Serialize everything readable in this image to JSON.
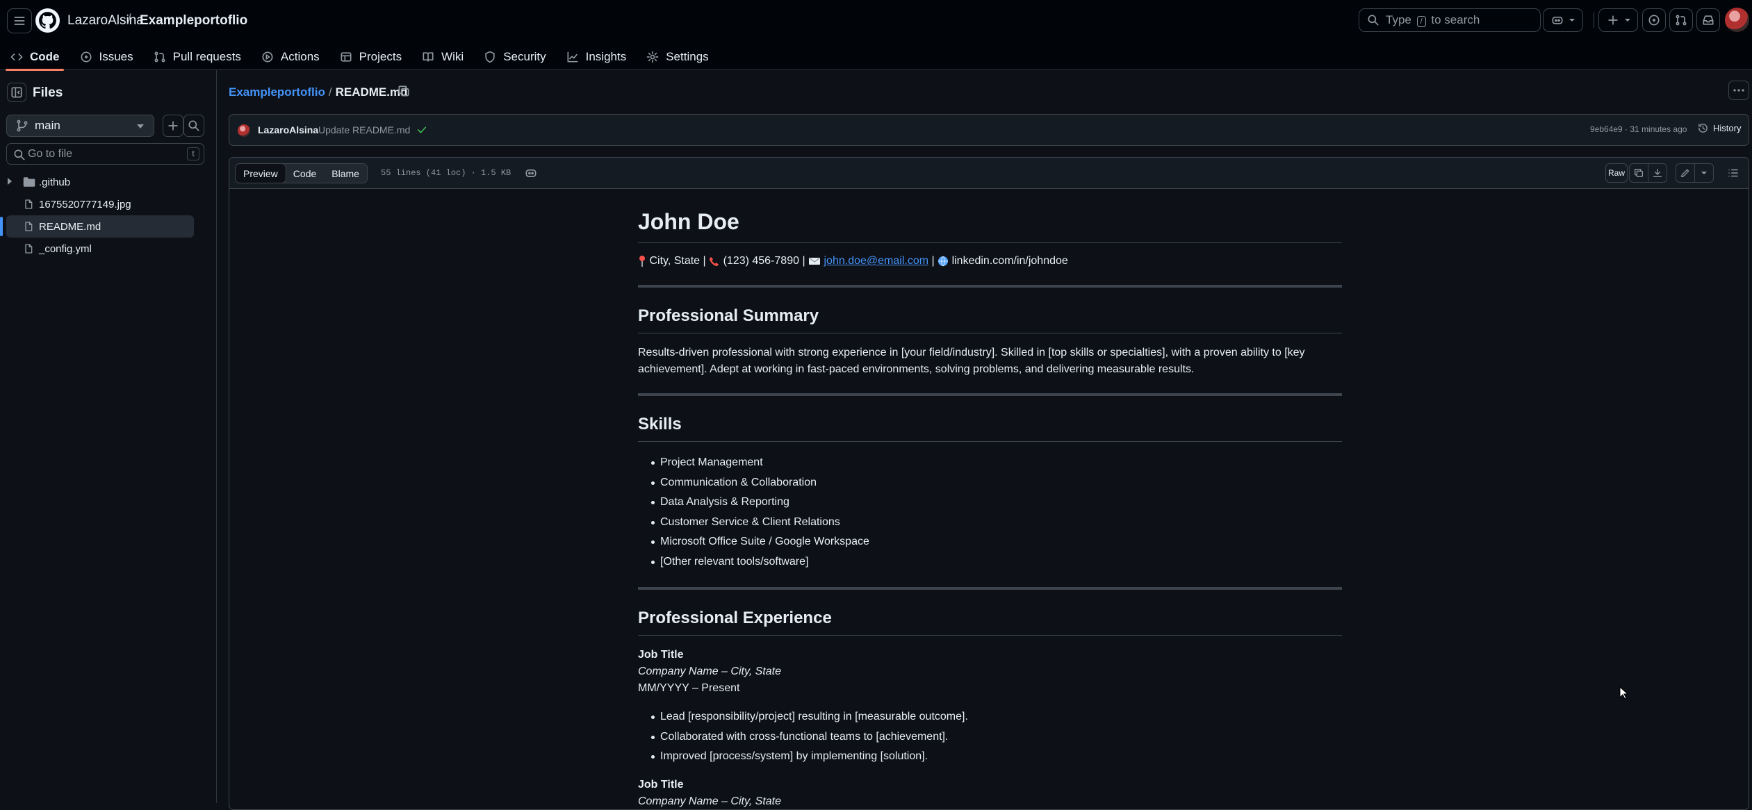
{
  "header": {
    "owner": "LazaroAlsina",
    "separator": "/",
    "repo": "Exampleportoflio",
    "search_prefix": "Type",
    "search_key": "/",
    "search_suffix": "to search"
  },
  "tabs": [
    {
      "label": "Code",
      "icon": "code-icon",
      "selected": true
    },
    {
      "label": "Issues",
      "icon": "issue-icon"
    },
    {
      "label": "Pull requests",
      "icon": "pull-request-icon"
    },
    {
      "label": "Actions",
      "icon": "play-icon"
    },
    {
      "label": "Projects",
      "icon": "table-icon"
    },
    {
      "label": "Wiki",
      "icon": "book-icon"
    },
    {
      "label": "Security",
      "icon": "shield-icon"
    },
    {
      "label": "Insights",
      "icon": "graph-icon"
    },
    {
      "label": "Settings",
      "icon": "gear-icon"
    }
  ],
  "sidebar": {
    "title": "Files",
    "branch": "main",
    "goto_placeholder": "Go to file",
    "goto_key": "t",
    "tree": [
      {
        "label": ".github",
        "type": "folder"
      },
      {
        "label": "1675520777149.jpg",
        "type": "file"
      },
      {
        "label": "README.md",
        "type": "file",
        "selected": true
      },
      {
        "label": "_config.yml",
        "type": "file"
      }
    ]
  },
  "main": {
    "crumb_repo": "Exampleportoflio",
    "crumb_sep": "/",
    "crumb_file": "README.md",
    "commit": {
      "author": "LazaroAlsina",
      "message": "Update README.md",
      "meta": "9eb64e9 · 31 minutes ago",
      "history_label": "History"
    },
    "file_bar": {
      "views": [
        "Preview",
        "Code",
        "Blame"
      ],
      "selected_view": "Preview",
      "lines_info": "55 lines (41 loc) · 1.5 KB",
      "raw_label": "Raw"
    }
  },
  "readme": {
    "name": "John Doe",
    "contact": {
      "city": "City, State |",
      "phone": "(123) 456-7890 |",
      "email": "john.doe@email.com",
      "pipe": "|",
      "linkedin": "linkedin.com/in/johndoe"
    },
    "summary_heading": "Professional Summary",
    "summary_text": "Results-driven professional with strong experience in [your field/industry]. Skilled in [top skills or specialties], with a proven ability to [key achievement]. Adept at working in fast-paced environments, solving problems, and delivering measurable results.",
    "skills_heading": "Skills",
    "skills": [
      "Project Management",
      "Communication & Collaboration",
      "Data Analysis & Reporting",
      "Customer Service & Client Relations",
      "Microsoft Office Suite / Google Workspace",
      "[Other relevant tools/software]"
    ],
    "experience_heading": "Professional Experience",
    "jobs": [
      {
        "title": "Job Title",
        "company": "Company Name – City, State",
        "dates": "MM/YYYY – Present",
        "bullets": [
          "Lead [responsibility/project] resulting in [measurable outcome].",
          "Collaborated with cross-functional teams to [achievement].",
          "Improved [process/system] by implementing [solution]."
        ]
      },
      {
        "title": "Job Title",
        "company": "Company Name – City, State"
      }
    ]
  }
}
